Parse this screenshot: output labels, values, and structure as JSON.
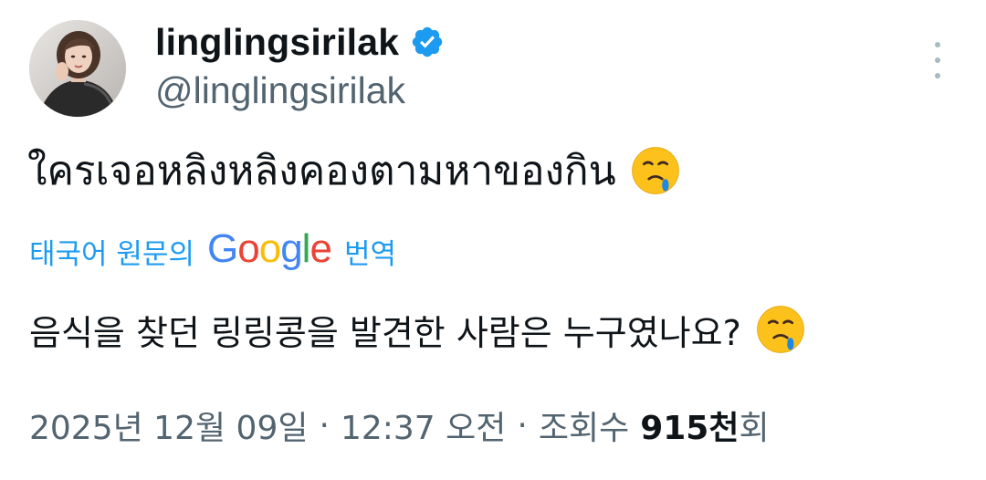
{
  "tweet": {
    "display_name": "linglingsirilak",
    "handle": "@linglingsirilak",
    "verified": true,
    "text": "ใครเจอหลิงหลิงคองตามหาของกิน",
    "emoji": "face-holding-back-tears",
    "translate": {
      "prefix": "태국어 원문의",
      "google_letters": [
        "G",
        "o",
        "o",
        "g",
        "l",
        "e"
      ],
      "suffix": "번역"
    },
    "translated_text": "음식을 찾던 링링콩을 발견한 사람은 누구였나요?",
    "meta": {
      "date": "2025년 12월 09일",
      "time": "12:37 오전",
      "separator": "·",
      "views_label": "조회수",
      "views_number": "915천",
      "views_unit": "회"
    }
  },
  "icons": {
    "verified": "verified-badge-icon",
    "more": "more-vertical-icon"
  },
  "colors": {
    "text": "#0f1419",
    "muted": "#536471",
    "accent": "#1d9bf0",
    "verified": "#1d9bf0"
  }
}
